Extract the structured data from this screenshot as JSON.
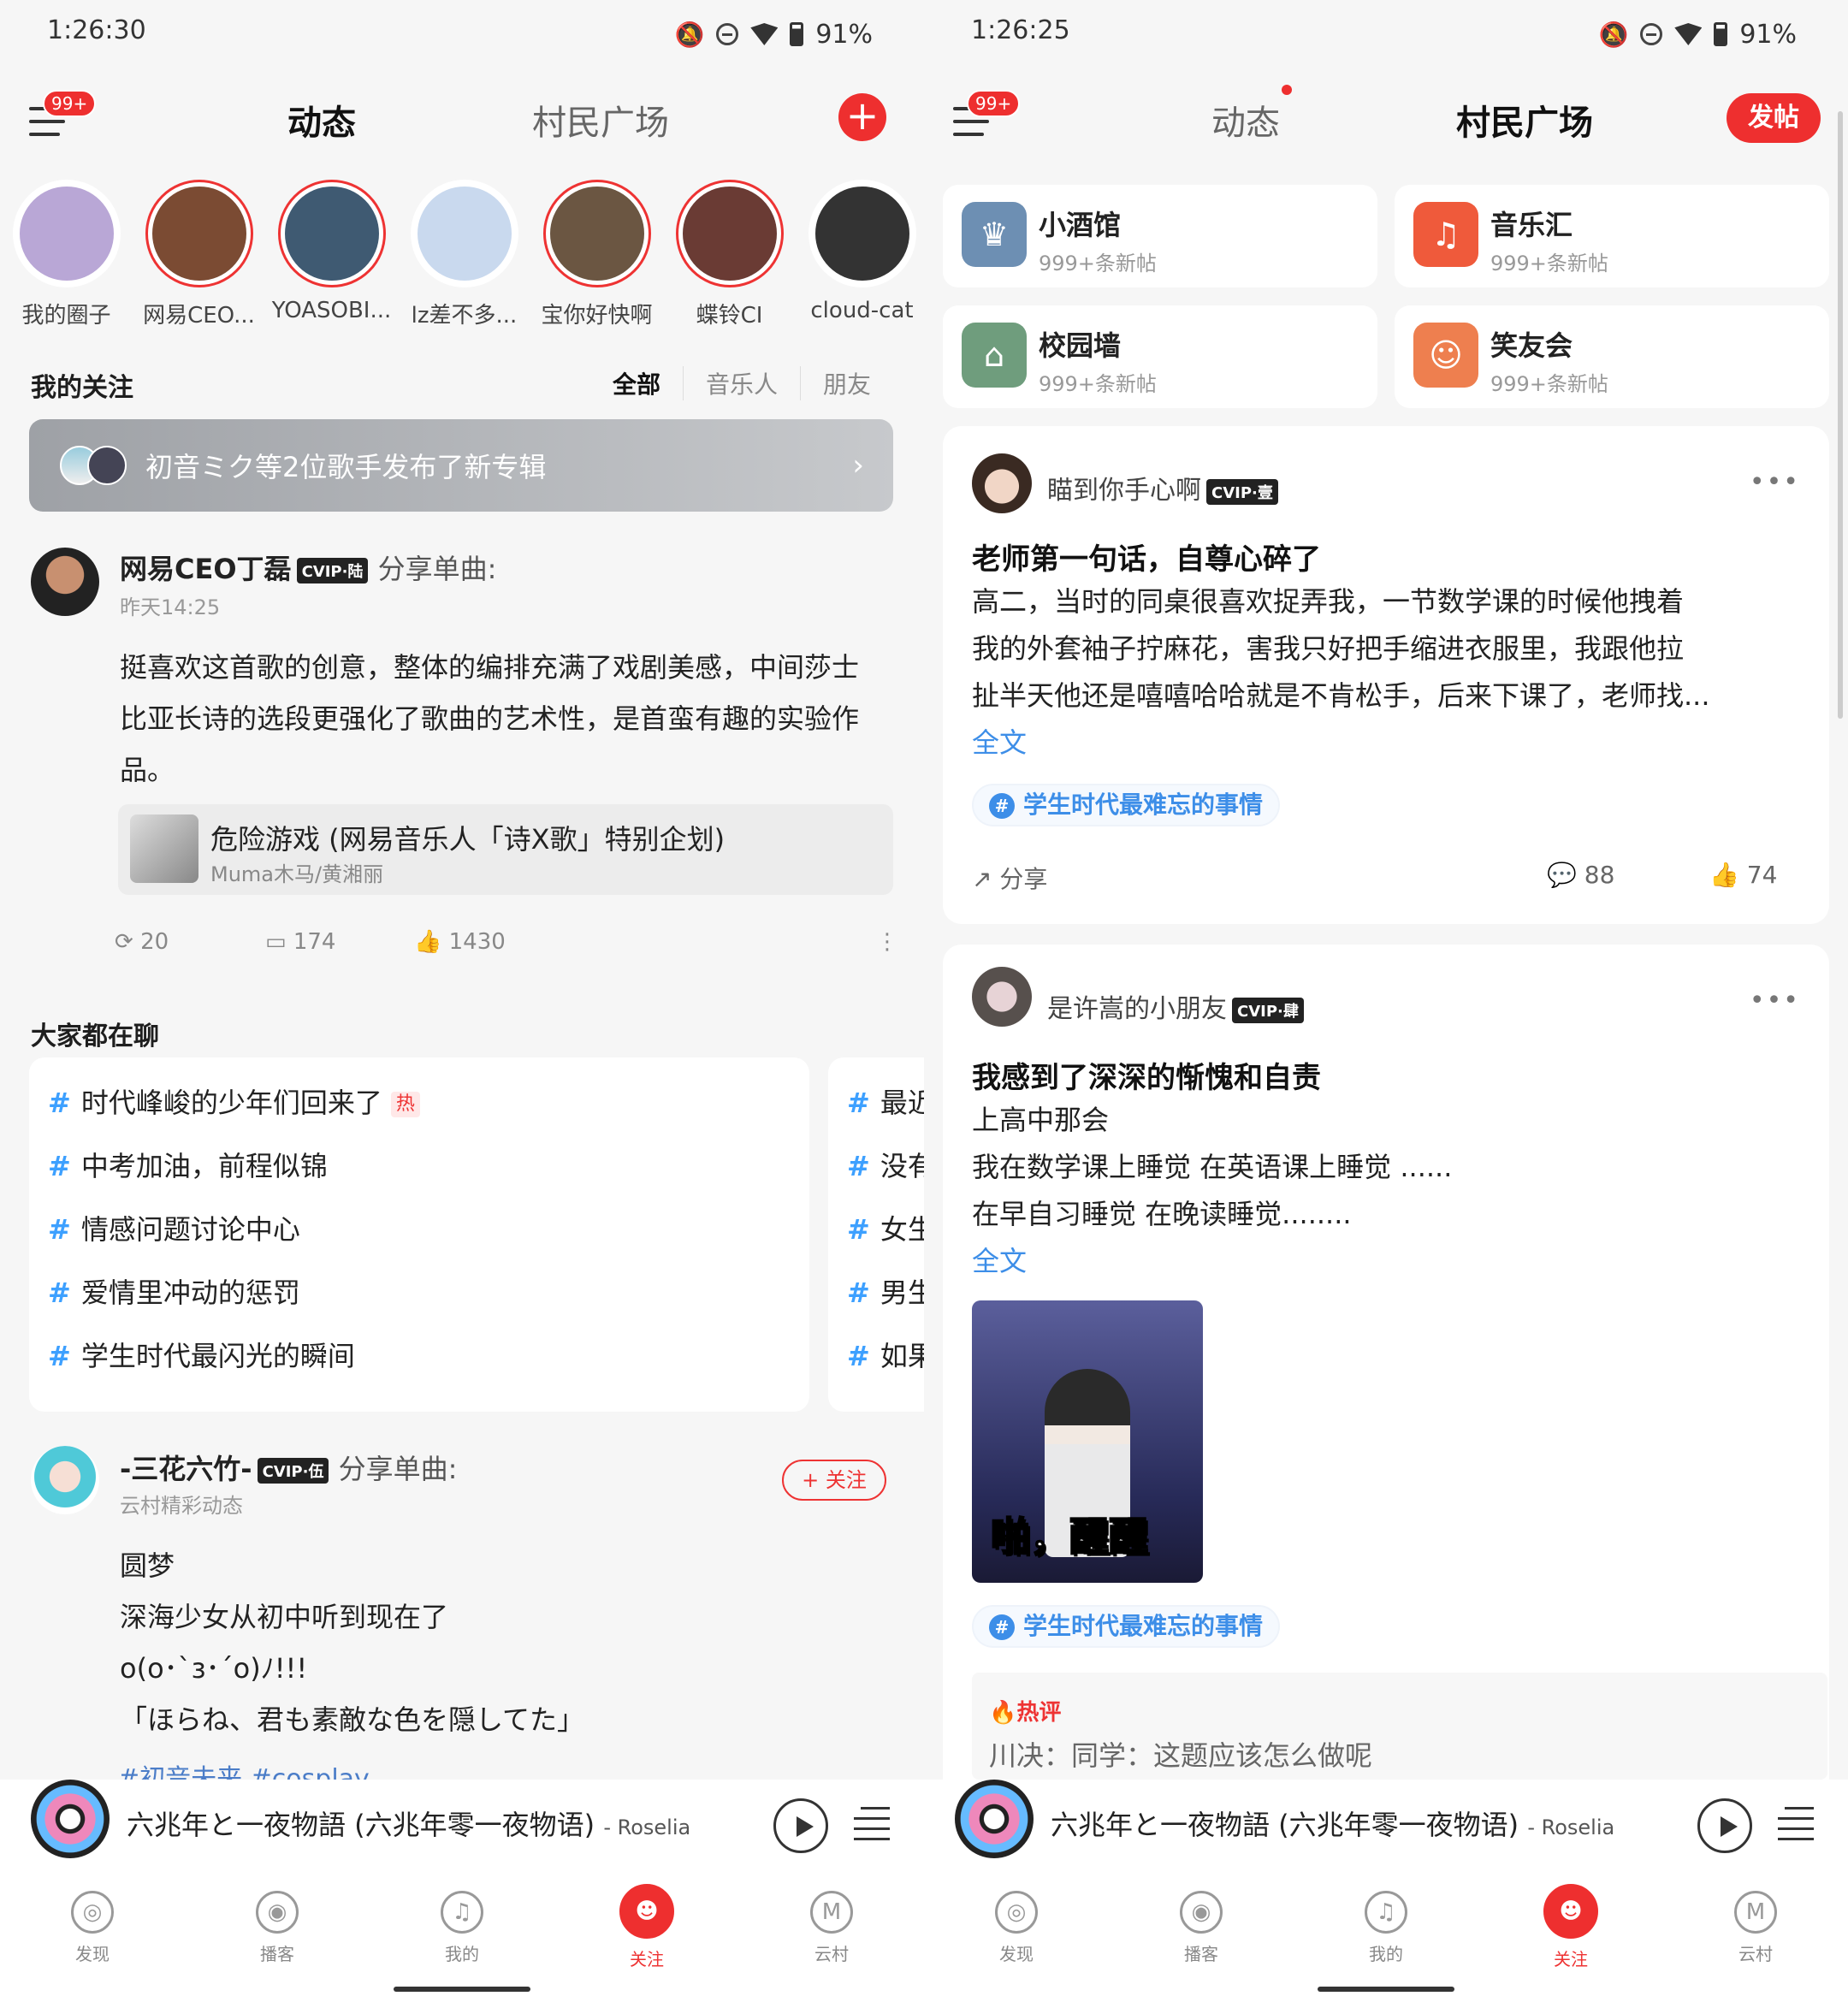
{
  "left": {
    "status": {
      "time": "1:26:30",
      "battery": "91%"
    },
    "nav": {
      "badge": "99+",
      "tab_dynamic": "动态",
      "tab_square": "村民广场",
      "plus": "+"
    },
    "stories": [
      {
        "label": "我的圈子",
        "color": "#b9a7d6"
      },
      {
        "label": "网易CEO...",
        "color": "#7b4b33"
      },
      {
        "label": "YOASOBI...",
        "color": "#3f5a72"
      },
      {
        "label": "lz差不多...",
        "color": "#c9d9ee"
      },
      {
        "label": "宝你好快啊",
        "color": "#6b5642"
      },
      {
        "label": "蝶铃CI",
        "color": "#6a3b34"
      },
      {
        "label": "cloud-cat",
        "color": "#333333"
      }
    ],
    "follow": {
      "title": "我的关注",
      "filter_all": "全部",
      "filter_musician": "音乐人",
      "filter_friend": "朋友"
    },
    "banner": {
      "text": "初音ミク等2位歌手发布了新专辑",
      "chevron": "›"
    },
    "post1": {
      "user": "网易CEO丁磊",
      "vip": "CVIP·陆",
      "action": "分享单曲:",
      "time": "昨天14:25",
      "lines": [
        "挺喜欢这首歌的创意，整体的编排充满了戏剧美感，中间莎士",
        "比亚长诗的选段更强化了歌曲的艺术性，是首蛮有趣的实验作",
        "品。"
      ],
      "song_title": "危险游戏 (网易音乐人「诗X歌」特别企划)",
      "song_artist": "Muma木马/黄湘丽",
      "repost": "20",
      "comments": "174",
      "likes": "1430",
      "more": "⋮"
    },
    "talk": {
      "title": "大家都在聊",
      "topics": [
        "时代峰峻的少年们回来了",
        "中考加油，前程似锦",
        "情感问题讨论中心",
        "爱情里冲动的惩罚",
        "学生时代最闪光的瞬间"
      ],
      "hot": "热",
      "topics2": [
        "最近",
        "没有",
        "女生",
        "男生",
        "如果"
      ],
      "hash": "#"
    },
    "post2": {
      "user": "-三花六竹-",
      "vip": "CVIP·伍",
      "action": "分享单曲:",
      "sub": "云村精彩动态",
      "follow": "+ 关注",
      "lines": [
        "圆梦",
        "深海少女从初中听到现在了",
        "o(o･`з･´o)ﾉ!!!",
        "「ほらね、君も素敵な色を隠してた」"
      ],
      "tags": "#初音未来   #cosplay"
    }
  },
  "right": {
    "status": {
      "time": "1:26:25",
      "battery": "91%"
    },
    "nav": {
      "badge": "99+",
      "tab_dynamic": "动态",
      "tab_square": "村民广场",
      "post": "发帖"
    },
    "forums": [
      {
        "name": "小酒馆",
        "count": "999+条新帖",
        "color": "#6d8fb3",
        "icon": "♛"
      },
      {
        "name": "音乐汇",
        "count": "999+条新帖",
        "color": "#ef5a3b",
        "icon": "♫"
      },
      {
        "name": "校园墙",
        "count": "999+条新帖",
        "color": "#6f9d7d",
        "icon": "⌂"
      },
      {
        "name": "笑友会",
        "count": "999+条新帖",
        "color": "#ee7f4f",
        "icon": "☺"
      }
    ],
    "card1": {
      "user": "瞄到你手心啊",
      "vip": "CVIP·壹",
      "more": "•••",
      "title": "老师第一句话，自尊心碎了",
      "lines": [
        "高二，当时的同桌很喜欢捉弄我，一节数学课的时候他拽着",
        "我的外套袖子拧麻花，害我只好把手缩进衣服里，我跟他拉",
        "扯半天他还是嘻嘻哈哈就是不肯松手，后来下课了，老师找..."
      ],
      "full": "全文",
      "topic": "学生时代最难忘的事情",
      "share": "分享",
      "comments": "88",
      "likes": "74"
    },
    "card2": {
      "user": "是许嵩的小朋友",
      "vip": "CVIP·肆",
      "more": "•••",
      "title": "我感到了深深的惭愧和自责",
      "lines": [
        "上高中那会",
        "我在数学课上睡觉 在英语课上睡觉 ......",
        "在早自习睡觉 在晚读睡觉........"
      ],
      "full": "全文",
      "photo_caption": "啪，醒醒",
      "topic": "学生时代最难忘的事情",
      "hot_label": "热评",
      "hot_text": "川决：同学：这题应该怎么做呢"
    }
  },
  "player": {
    "title": "六兆年と一夜物語 (六兆年零一夜物语)",
    "artist": "- Roselia"
  },
  "tabbar": [
    {
      "label": "发现",
      "icon": "◎"
    },
    {
      "label": "播客",
      "icon": "◉"
    },
    {
      "label": "我的",
      "icon": "♫"
    },
    {
      "label": "关注",
      "icon": "☻"
    },
    {
      "label": "云村",
      "icon": "M"
    }
  ]
}
